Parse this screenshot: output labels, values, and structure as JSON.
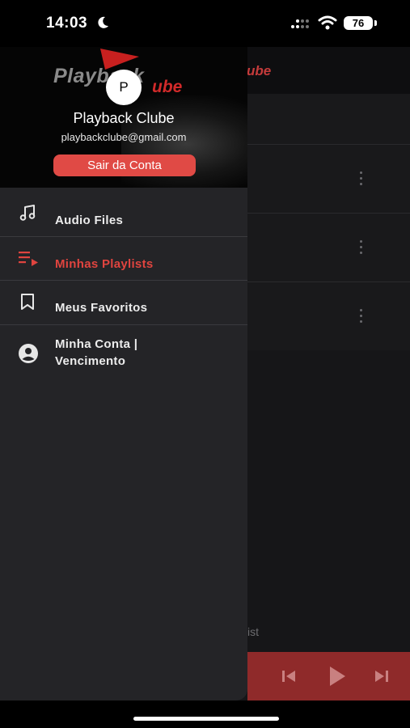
{
  "status_bar": {
    "time": "14:03",
    "battery": "76"
  },
  "app": {
    "title_fragment": "ube",
    "footer_fragment": "ist"
  },
  "drawer": {
    "logo": {
      "text_top": "Playback",
      "text_bottom": "ube"
    },
    "avatar_initial": "P",
    "user_name": "Playback Clube",
    "user_email": "playbackclube@gmail.com",
    "logout_label": "Sair da Conta",
    "menu": [
      {
        "label": "Audio Files",
        "icon": "music-note-icon",
        "active": false
      },
      {
        "label": "Minhas Playlists",
        "icon": "playlist-play-icon",
        "active": true
      },
      {
        "label": "Meus Favoritos",
        "icon": "bookmark-icon",
        "active": false
      },
      {
        "label": "Minha Conta | Vencimento",
        "icon": "account-circle-icon",
        "active": false
      }
    ]
  },
  "colors": {
    "accent": "#e0443f",
    "drawer_bg": "#242427",
    "player_bg": "#8f2a2a"
  }
}
